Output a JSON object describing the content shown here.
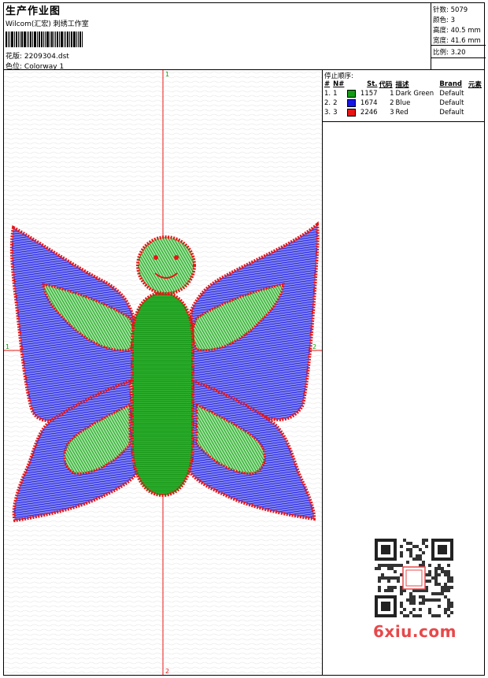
{
  "header": {
    "title": "生产作业图",
    "company": "Wilcom(汇宏) 刺绣工作室",
    "design_label": "花版:",
    "design_value": "2209304.dst",
    "colorway_label": "色位:",
    "colorway_value": "Colorway 1"
  },
  "stats": {
    "stitches_label": "针数:",
    "stitches_value": "5079",
    "colors_label": "颜色:",
    "colors_value": "3",
    "height_label": "高度:",
    "height_value": "40.5 mm",
    "width_label": "宽度:",
    "width_value": "41.6 mm",
    "scale_label": "比例:",
    "scale_value": "3.20"
  },
  "canvas": {
    "top_marker": "1",
    "bottom_marker": "2",
    "left_marker": "1",
    "right_marker": "2"
  },
  "stop_sequence": {
    "title": "停止顺序:",
    "columns": [
      "#",
      "N#",
      "St.",
      "代码",
      "描述",
      "Brand",
      "元素"
    ],
    "rows": [
      {
        "num": "1.",
        "n": "1",
        "swatch": "#139c13",
        "st": "1157",
        "code": "1",
        "desc": "Dark Green",
        "brand": "Default"
      },
      {
        "num": "2.",
        "n": "2",
        "swatch": "#1515e6",
        "st": "1674",
        "code": "2",
        "desc": "Blue",
        "brand": "Default"
      },
      {
        "num": "3.",
        "n": "3",
        "swatch": "#e81414",
        "st": "2246",
        "code": "3",
        "desc": "Red",
        "brand": "Default"
      }
    ]
  },
  "watermark": "6xiu.com",
  "colors": {
    "green": "#139c13",
    "light_green": "#7fd67f",
    "blue": "#1515e6",
    "light_blue": "#9aa0ee",
    "red": "#e81414"
  }
}
